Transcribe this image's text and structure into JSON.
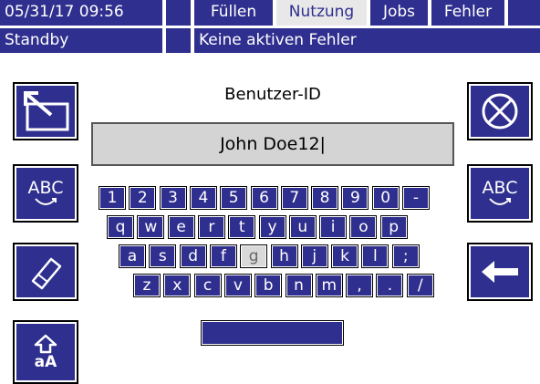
{
  "header": {
    "datetime": "05/31/17 09:56",
    "status": "Standby",
    "message": "Keine aktiven Fehler",
    "tabs": [
      {
        "label": "Füllen",
        "active": false
      },
      {
        "label": "Nutzung",
        "active": true
      },
      {
        "label": "Jobs",
        "active": false
      },
      {
        "label": "Fehler",
        "active": false
      }
    ]
  },
  "form": {
    "label": "Benutzer-ID",
    "value": "John Doe12|"
  },
  "keyboard": {
    "row1": [
      "1",
      "2",
      "3",
      "4",
      "5",
      "6",
      "7",
      "8",
      "9",
      "0",
      "-"
    ],
    "row2": [
      "q",
      "w",
      "e",
      "r",
      "t",
      "y",
      "u",
      "i",
      "o",
      "p"
    ],
    "row3": [
      "a",
      "s",
      "d",
      "f",
      "g",
      "h",
      "j",
      "k",
      "l",
      ";"
    ],
    "row4": [
      "z",
      "x",
      "c",
      "v",
      "b",
      "n",
      "m",
      ",",
      ".",
      "/"
    ],
    "selected_key": "g",
    "space": ""
  },
  "side_buttons": {
    "abc_left": "ABC",
    "abc_right": "ABC",
    "shift_text": "aA"
  },
  "colors": {
    "primary": "#2f2f8f",
    "selected_key": "#d9d9d9",
    "field": "#d4d4d4"
  }
}
